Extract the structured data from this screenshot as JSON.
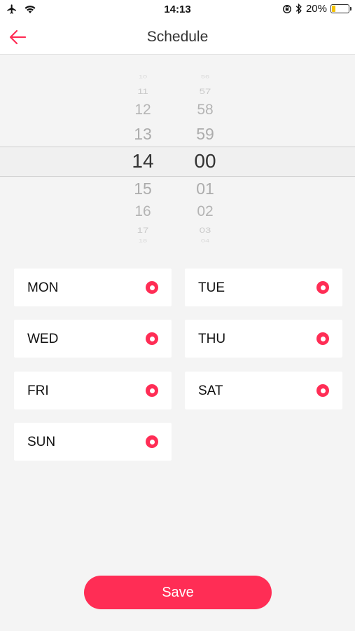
{
  "status_bar": {
    "time": "14:13",
    "battery_text": "20%",
    "battery_level": 0.2,
    "icons": [
      "airplane-icon",
      "wifi-icon",
      "orientation-lock-icon",
      "bluetooth-icon",
      "battery-icon"
    ]
  },
  "nav": {
    "title": "Schedule",
    "back_icon": "back-arrow-icon",
    "accent_color": "#ff2d55"
  },
  "picker": {
    "hours": [
      "10",
      "11",
      "12",
      "13",
      "14",
      "15",
      "16",
      "17",
      "18"
    ],
    "minutes": [
      "56",
      "57",
      "58",
      "59",
      "00",
      "01",
      "02",
      "03",
      "04"
    ],
    "selected_hour": "14",
    "selected_minute": "00"
  },
  "days": [
    {
      "label": "MON",
      "selected": true
    },
    {
      "label": "TUE",
      "selected": true
    },
    {
      "label": "WED",
      "selected": true
    },
    {
      "label": "THU",
      "selected": true
    },
    {
      "label": "FRI",
      "selected": true
    },
    {
      "label": "SAT",
      "selected": true
    },
    {
      "label": "SUN",
      "selected": true
    }
  ],
  "save_label": "Save"
}
